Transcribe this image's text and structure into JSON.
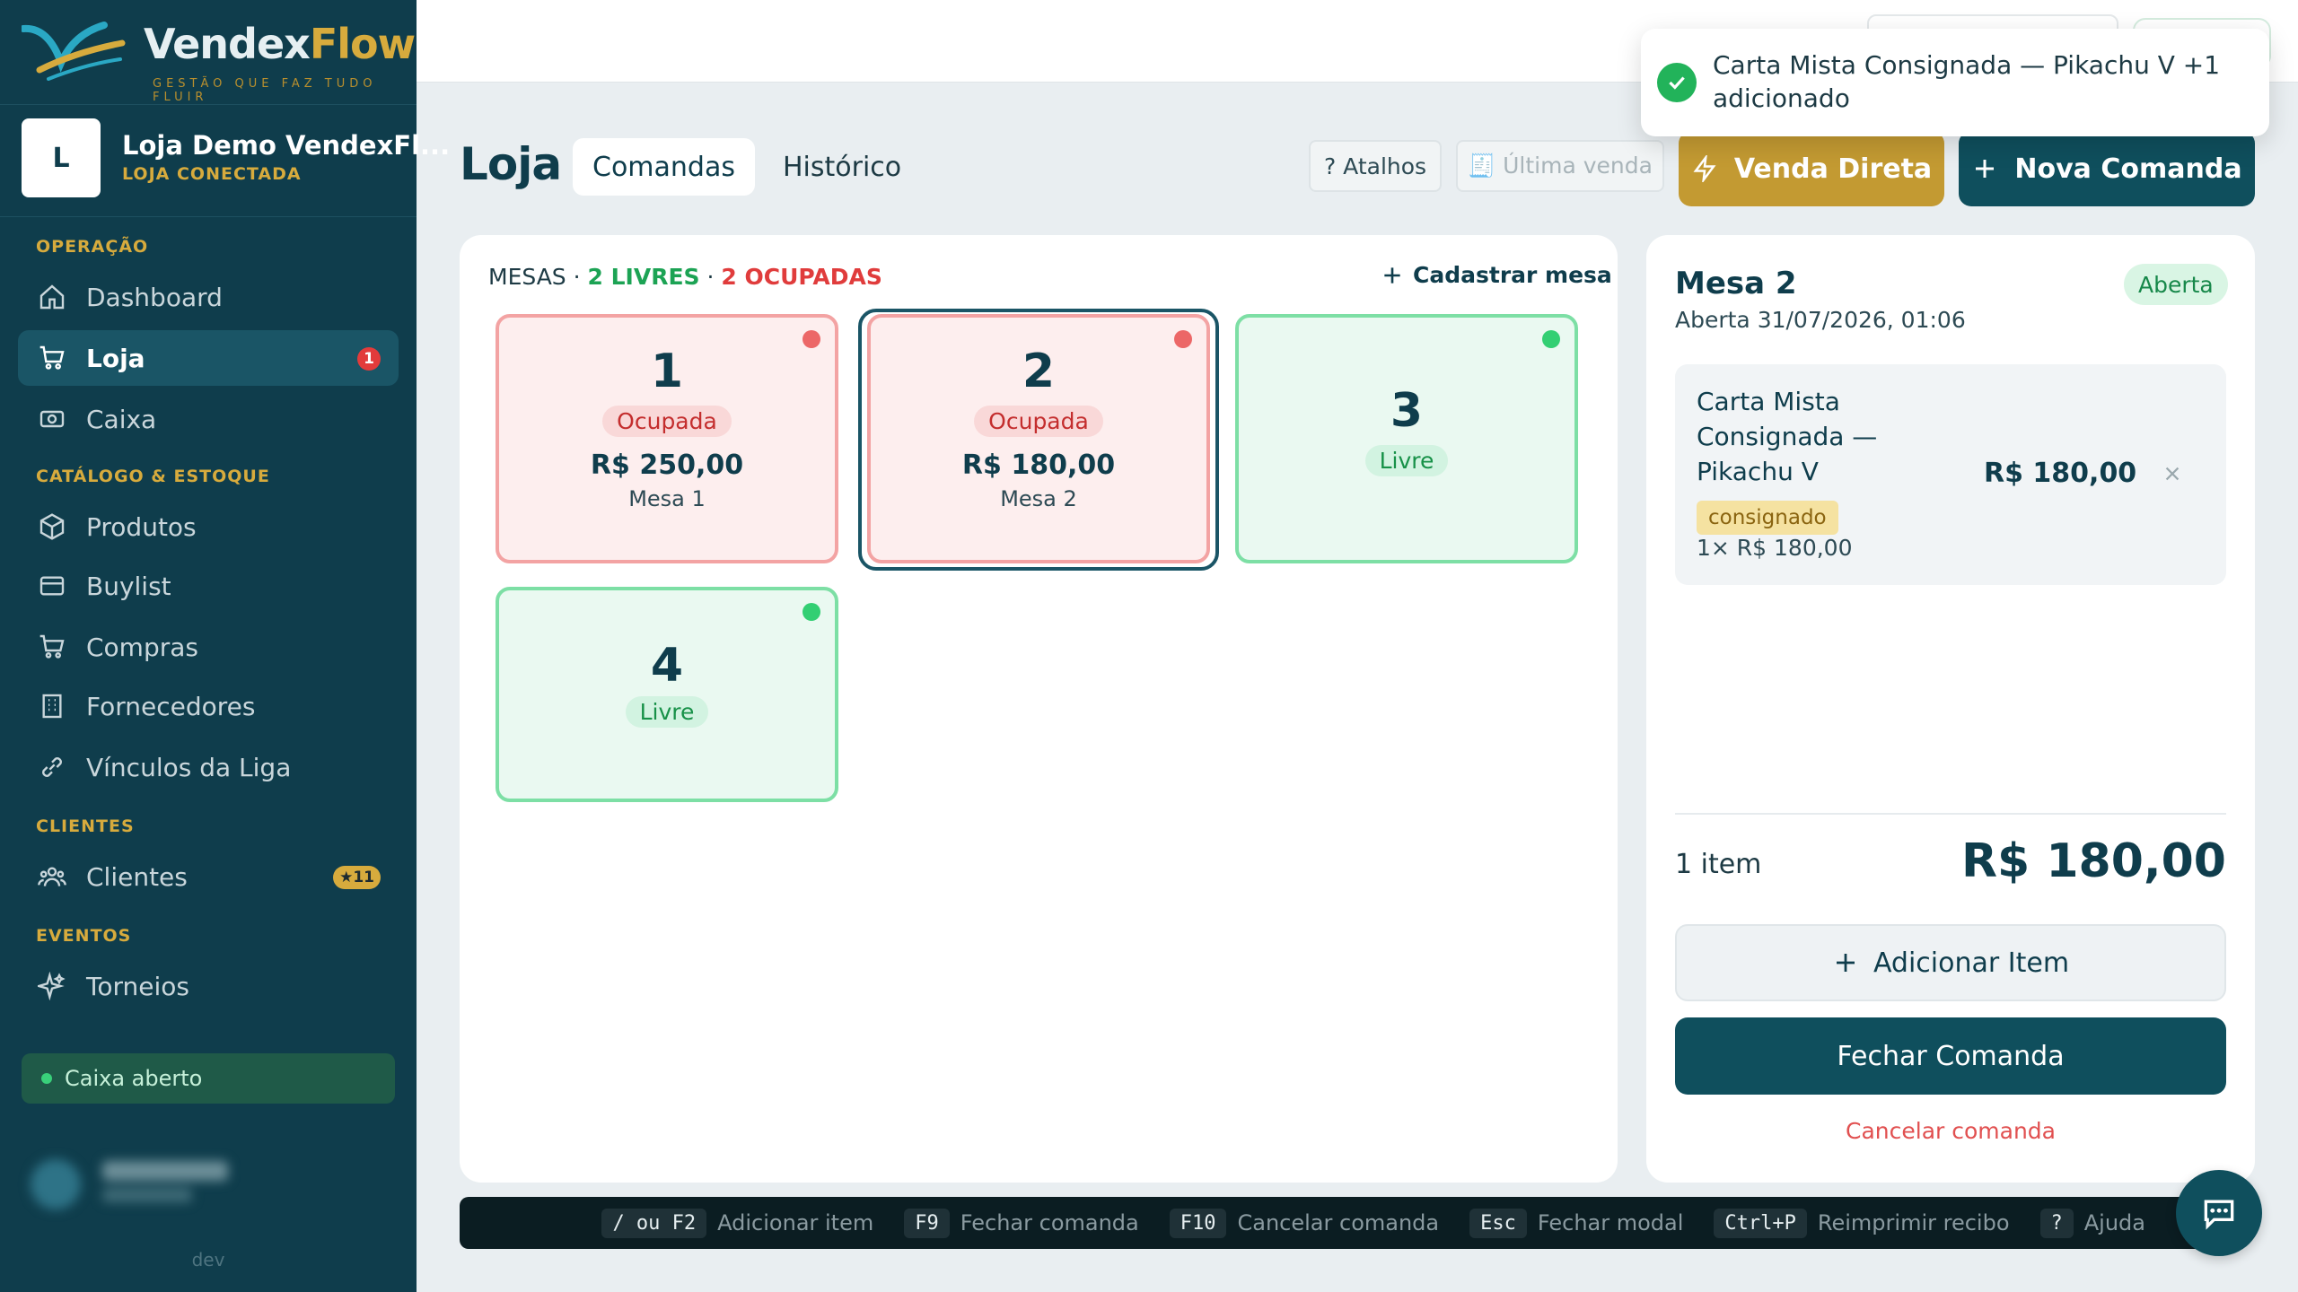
{
  "brand": {
    "name_part1": "Vendex",
    "name_part2": "Flow",
    "tagline": "GESTÃO QUE FAZ TUDO FLUIR",
    "logo_colors": [
      "#2aa8c4",
      "#d7ab3d"
    ]
  },
  "store": {
    "initial": "L",
    "name": "Loja Demo VendexFl...",
    "status": "LOJA CONECTADA"
  },
  "sidebar": {
    "sections": {
      "operacao": "OPERAÇÃO",
      "catalogo": "CATÁLOGO & ESTOQUE",
      "clientes": "CLIENTES",
      "eventos": "EVENTOS"
    },
    "items": [
      {
        "label": "Dashboard",
        "icon": "home-icon"
      },
      {
        "label": "Loja",
        "icon": "cart-icon",
        "active": true,
        "badge": "1"
      },
      {
        "label": "Caixa",
        "icon": "cash-register-icon"
      },
      {
        "label": "Produtos",
        "icon": "box-icon"
      },
      {
        "label": "Buylist",
        "icon": "credit-card-icon"
      },
      {
        "label": "Compras",
        "icon": "cart-icon"
      },
      {
        "label": "Fornecedores",
        "icon": "building-icon"
      },
      {
        "label": "Vínculos da Liga",
        "icon": "link-icon"
      },
      {
        "label": "Clientes",
        "icon": "users-icon",
        "badge": "★11"
      },
      {
        "label": "Torneios",
        "icon": "sparkles-icon"
      }
    ],
    "caixa_status": "Caixa aberto",
    "env_label": "dev"
  },
  "header": {
    "title": "Loja",
    "tabs": [
      {
        "label": "Comandas",
        "active": true
      },
      {
        "label": "Histórico"
      }
    ],
    "shortcuts_btn": "? Atalhos",
    "last_sale_btn": "🧾 Última venda",
    "direct_sale_btn": "Venda Direta",
    "new_order_btn": "Nova Comanda"
  },
  "tables": {
    "label": "MESAS",
    "sep": "·",
    "free_summary": "2 LIVRES",
    "occupied_summary": "2 OCUPADAS",
    "add_label": "Cadastrar mesa",
    "items": [
      {
        "number": "1",
        "status": "Ocupada",
        "amount": "R$ 250,00",
        "name": "Mesa 1",
        "state": "occupied"
      },
      {
        "number": "2",
        "status": "Ocupada",
        "amount": "R$ 180,00",
        "name": "Mesa 2",
        "state": "occupied",
        "selected": true
      },
      {
        "number": "3",
        "status": "Livre",
        "state": "free"
      },
      {
        "number": "4",
        "status": "Livre",
        "state": "free"
      }
    ]
  },
  "order": {
    "title": "Mesa 2",
    "opened_at": "Aberta 31/07/2026, 01:06",
    "status": "Aberta",
    "items": [
      {
        "name": "Carta Mista Consignada — Pikachu V",
        "tag": "consignado",
        "qty_line": "1× R$ 180,00",
        "price": "R$ 180,00"
      }
    ],
    "count_label": "1 item",
    "total": "R$ 180,00",
    "add_item_btn": "Adicionar Item",
    "close_btn": "Fechar Comanda",
    "cancel_link": "Cancelar comanda"
  },
  "shortcuts": [
    {
      "key": "/ ou F2",
      "label": "Adicionar item"
    },
    {
      "key": "F9",
      "label": "Fechar comanda"
    },
    {
      "key": "F10",
      "label": "Cancelar comanda"
    },
    {
      "key": "Esc",
      "label": "Fechar modal"
    },
    {
      "key": "Ctrl+P",
      "label": "Reimprimir recibo"
    },
    {
      "key": "?",
      "label": "Ajuda"
    }
  ],
  "toast": {
    "message": "Carta Mista Consignada — Pikachu V +1 adicionado",
    "icon": "check-circle-icon"
  },
  "colors": {
    "primary": "#0f4f5d",
    "sidebar": "#0f3d4c",
    "gold": "#d7ab3d",
    "danger": "#e03c3c",
    "success": "#1ca354"
  }
}
